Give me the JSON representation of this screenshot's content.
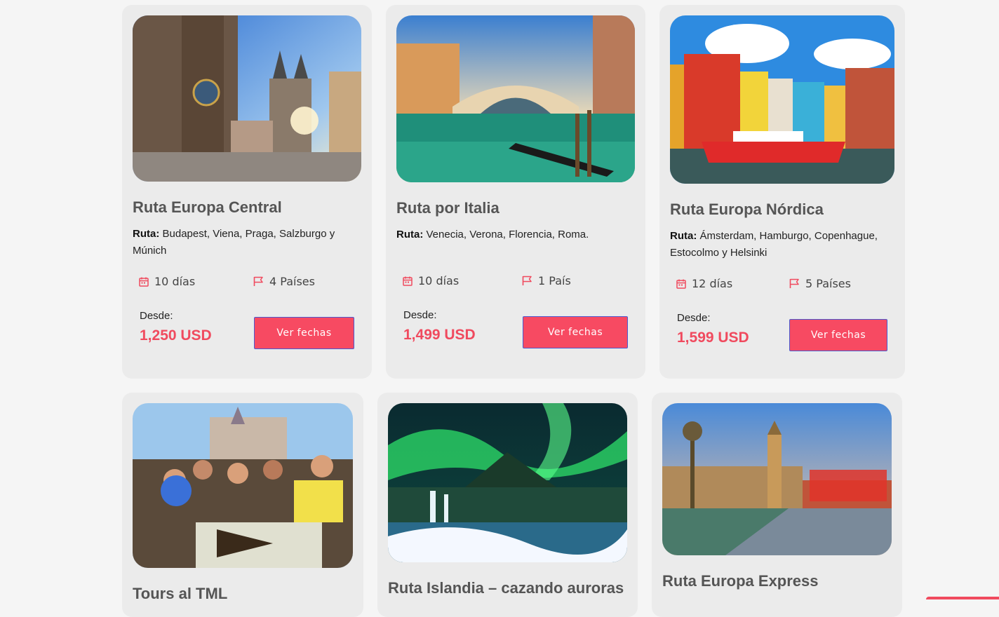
{
  "colors": {
    "accent": "#f74a62",
    "price": "#f04a5e",
    "card_bg": "#ebebeb",
    "page_bg": "#f5f5f5"
  },
  "cards": [
    {
      "title": "Ruta Europa Central",
      "route_label": "Ruta:",
      "route": "Budapest, Viena, Praga, Salzburgo y Múnich",
      "days": "10 días",
      "countries": "4 Países",
      "from_label": "Desde:",
      "price": "1,250 USD",
      "button": "Ver fechas",
      "image": "Prague old town square"
    },
    {
      "title": "Ruta por Italia",
      "route_label": "Ruta:",
      "route": "Venecia, Verona, Florencia, Roma.",
      "days": "10 días",
      "countries": "1 País",
      "from_label": "Desde:",
      "price": "1,499 USD",
      "button": "Ver fechas",
      "image": "Venice Rialto bridge"
    },
    {
      "title": "Ruta Europa Nórdica",
      "route_label": "Ruta:",
      "route": "Ámsterdam, Hamburgo, Copenhague, Estocolmo y Helsinki",
      "days": "12 días",
      "countries": "5 Países",
      "from_label": "Desde:",
      "price": "1,599 USD",
      "button": "Ver fechas",
      "image": "Copenhagen Nyhavn"
    },
    {
      "title": "Tours al TML",
      "image": "Festival crowd"
    },
    {
      "title": "Ruta Islandia – cazando auroras",
      "image": "Northern lights over Kirkjufell"
    },
    {
      "title": "Ruta Europa Express",
      "image": "London Big Ben"
    }
  ],
  "icons": {
    "days": "calendar-icon",
    "countries": "flag-icon"
  }
}
